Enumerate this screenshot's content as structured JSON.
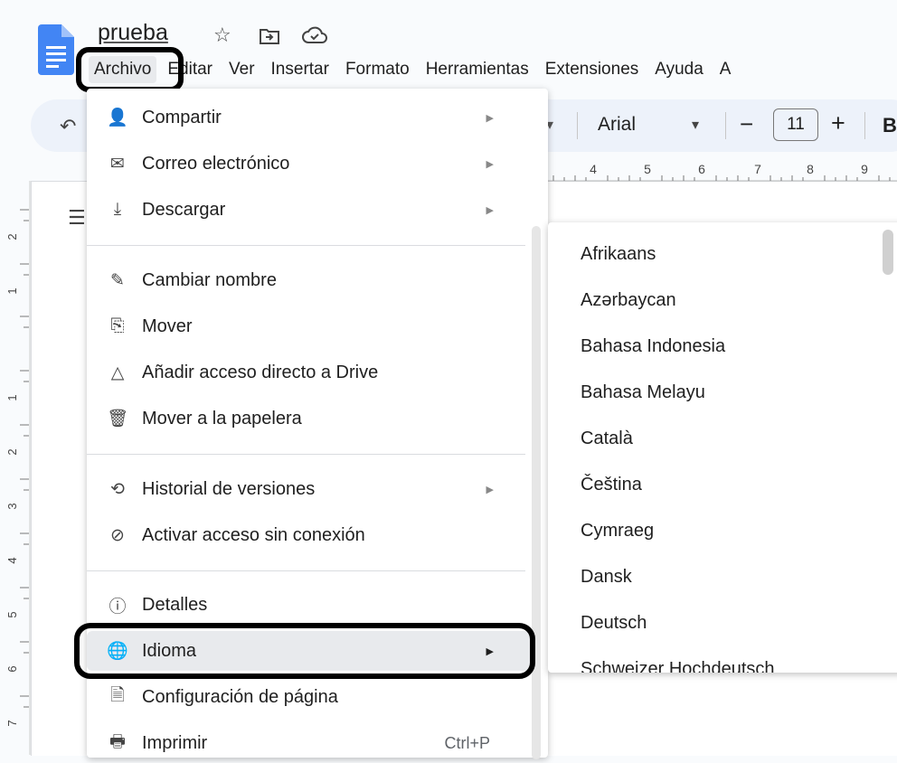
{
  "doc": {
    "title": "prueba"
  },
  "menubar": [
    "Archivo",
    "Editar",
    "Ver",
    "Insertar",
    "Formato",
    "Herramientas",
    "Extensiones",
    "Ayuda",
    "A"
  ],
  "toolbar": {
    "font": "Arial",
    "size": "11",
    "minus": "−",
    "plus": "+",
    "bold": "B"
  },
  "ruler": {
    "h": [
      "4",
      "5",
      "6",
      "7",
      "8",
      "9"
    ],
    "v": [
      "2",
      "1",
      "1",
      "2",
      "3",
      "4",
      "5",
      "6",
      "7"
    ]
  },
  "file_menu": {
    "items": [
      {
        "label": "Compartir",
        "icon": "share-icon",
        "arrow": true
      },
      {
        "label": "Correo electrónico",
        "icon": "mail-icon",
        "arrow": true
      },
      {
        "label": "Descargar",
        "icon": "download-icon",
        "arrow": true
      },
      {
        "label": "Cambiar nombre",
        "icon": "rename-icon"
      },
      {
        "label": "Mover",
        "icon": "move-folder-icon"
      },
      {
        "label": "Añadir acceso directo a Drive",
        "icon": "drive-shortcut-icon"
      },
      {
        "label": "Mover a la papelera",
        "icon": "trash-icon"
      },
      {
        "label": "Historial de versiones",
        "icon": "history-icon",
        "arrow": true
      },
      {
        "label": "Activar acceso sin conexión",
        "icon": "offline-icon"
      },
      {
        "label": "Detalles",
        "icon": "info-icon"
      },
      {
        "label": "Idioma",
        "icon": "globe-icon",
        "arrow": true,
        "active": true
      },
      {
        "label": "Configuración de página",
        "icon": "page-setup-icon"
      },
      {
        "label": "Imprimir",
        "icon": "print-icon",
        "shortcut": "Ctrl+P"
      }
    ]
  },
  "language_submenu": {
    "items": [
      "Afrikaans",
      "Azərbaycan",
      "Bahasa Indonesia",
      "Bahasa Melayu",
      "Català",
      "Čeština",
      "Cymraeg",
      "Dansk",
      "Deutsch",
      "Schweizer Hochdeutsch"
    ]
  }
}
